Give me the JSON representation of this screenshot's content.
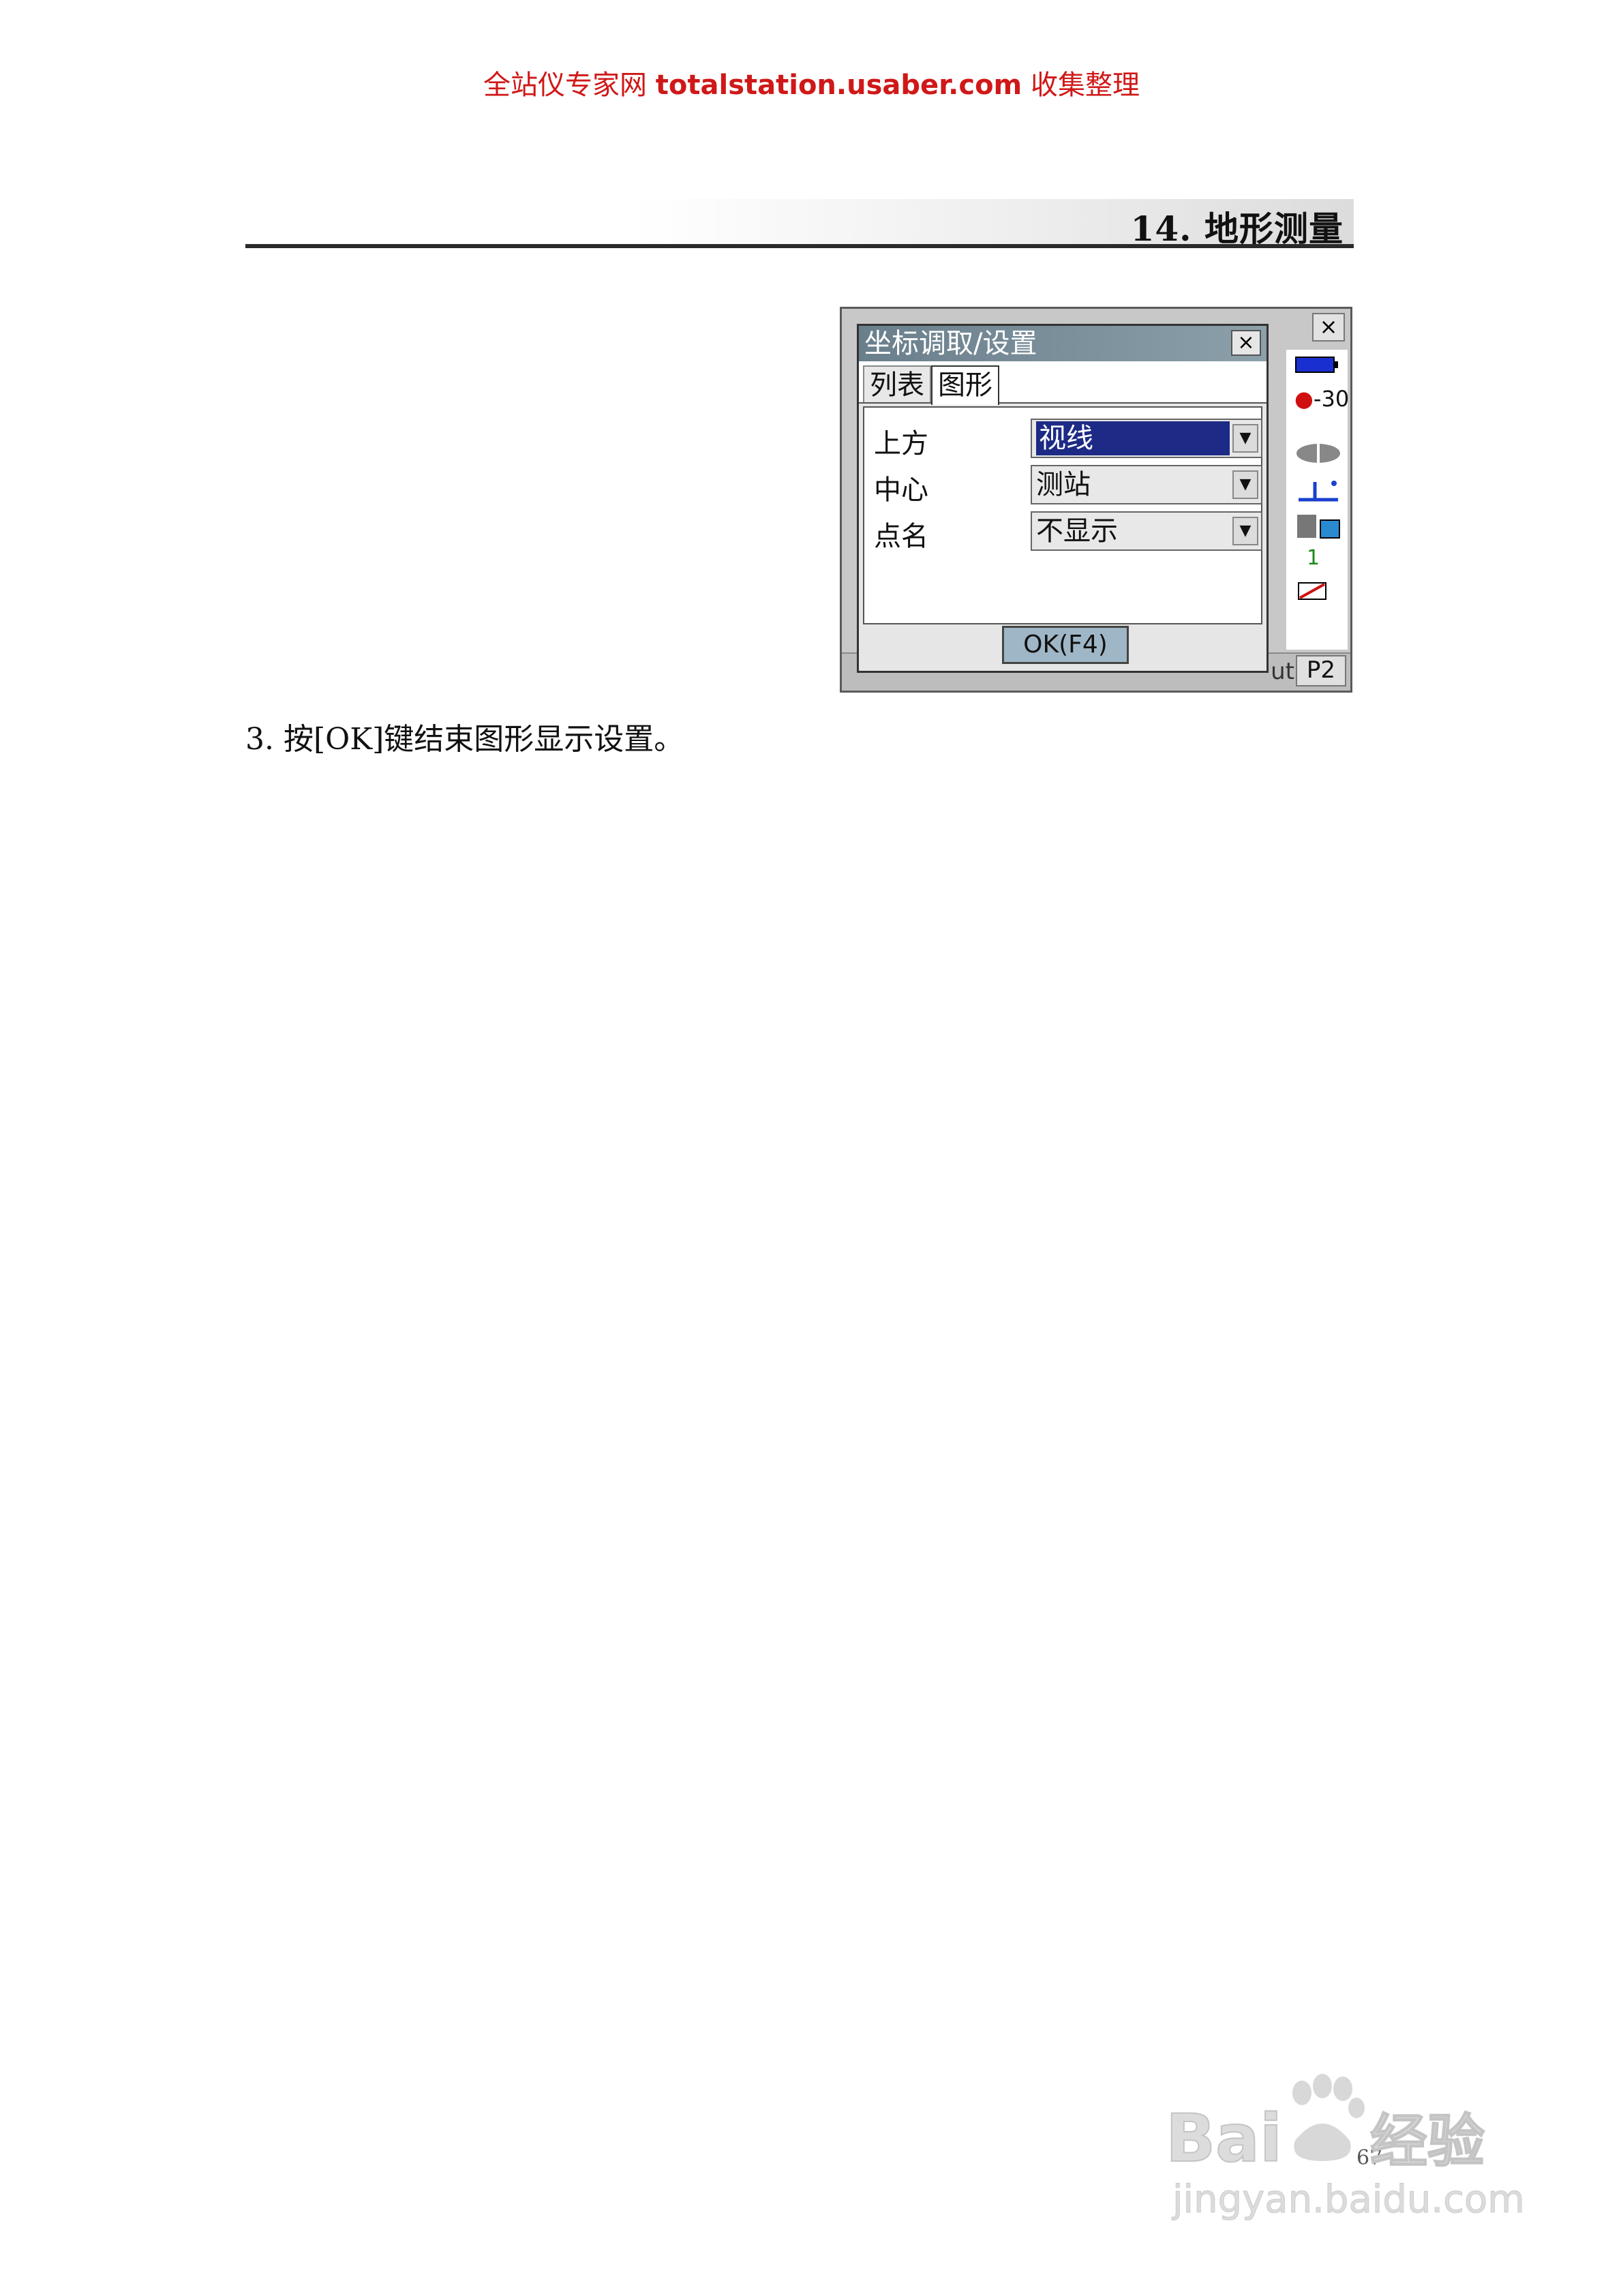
{
  "watermark": {
    "prefix": "全站仪专家网",
    "site": "totalstation.usaber.com",
    "suffix": "收集整理"
  },
  "header": {
    "title": "14. 地形测量"
  },
  "device": {
    "dialog_title": "坐标调取/设置",
    "tabs": [
      "列表",
      "图形"
    ],
    "active_tab": "图形",
    "fields": [
      {
        "label": "上方",
        "value": "视线"
      },
      {
        "label": "中心",
        "value": "测站"
      },
      {
        "label": "点名",
        "value": "不显示"
      }
    ],
    "ok_button": "OK(F4)",
    "close_symbol": "×",
    "status": {
      "prism_const": "-30",
      "count": "1"
    },
    "page_indicator": "P2",
    "bottom_fragment": "ut"
  },
  "step": "3.   按[OK]键结束图形显示设置。",
  "page_number": "67",
  "logo": {
    "brand": "Bai 经验",
    "url": "jingyan.baidu.com"
  }
}
